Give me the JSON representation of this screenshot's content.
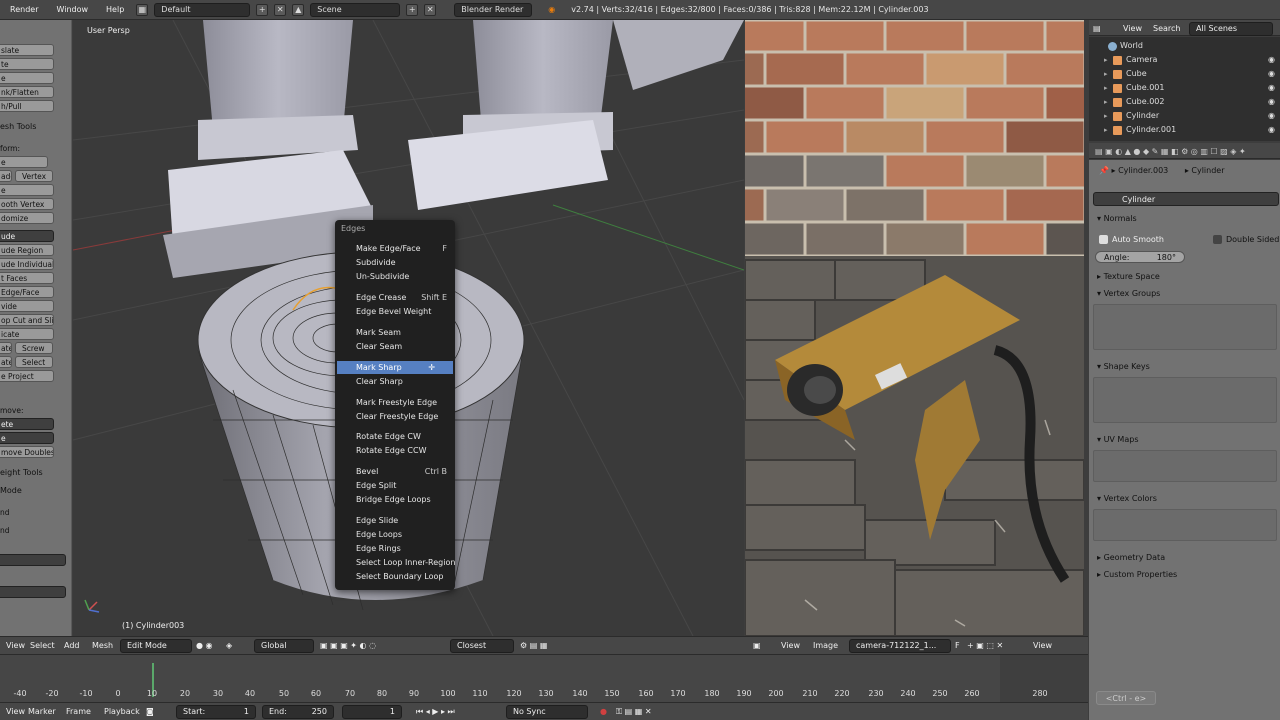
{
  "topbar": {
    "menus": [
      "Render",
      "Window",
      "Help"
    ],
    "screen_layout": "Default",
    "scene": "Scene",
    "engine": "Blender Render",
    "stats": "v2.74 | Verts:32/416 | Edges:32/800 | Faces:0/386 | Tris:828 | Mem:22.12M | Cylinder.003"
  },
  "toolshelf": {
    "items": [
      "slate",
      "te",
      "e",
      "nk/Flatten",
      "h/Pull",
      "esh Tools",
      "form:",
      "e",
      "ade Ed",
      "Vertex",
      "e",
      "ooth Vertex",
      "domize",
      "ude",
      "ude Region",
      "ude Individual",
      "t Faces",
      "Edge/Face",
      "vide",
      "op Cut and Sli...",
      "icate",
      "ate",
      "Screw",
      "ate",
      "Select",
      "e Project",
      "move:",
      "ete",
      "e",
      "move Doubles",
      "eight Tools",
      "Mode",
      "nd",
      "nd"
    ]
  },
  "viewport": {
    "view_name": "User Persp",
    "object_label": "(1) Cylinder003"
  },
  "context_menu": {
    "title": "Edges",
    "items": [
      {
        "label": "Make Edge/Face",
        "shortcut": "F"
      },
      {
        "label": "Subdivide",
        "shortcut": ""
      },
      {
        "label": "Un-Subdivide",
        "shortcut": ""
      },
      {
        "label": "Edge Crease",
        "shortcut": "Shift E"
      },
      {
        "label": "Edge Bevel Weight",
        "shortcut": ""
      },
      {
        "label": "Mark Seam",
        "shortcut": ""
      },
      {
        "label": "Clear Seam",
        "shortcut": ""
      },
      {
        "label": "Mark Sharp",
        "shortcut": ""
      },
      {
        "label": "Clear Sharp",
        "shortcut": ""
      },
      {
        "label": "Mark Freestyle Edge",
        "shortcut": ""
      },
      {
        "label": "Clear Freestyle Edge",
        "shortcut": ""
      },
      {
        "label": "Rotate Edge CW",
        "shortcut": ""
      },
      {
        "label": "Rotate Edge CCW",
        "shortcut": ""
      },
      {
        "label": "Bevel",
        "shortcut": "Ctrl B"
      },
      {
        "label": "Edge Split",
        "shortcut": ""
      },
      {
        "label": "Bridge Edge Loops",
        "shortcut": ""
      },
      {
        "label": "Edge Slide",
        "shortcut": ""
      },
      {
        "label": "Edge Loops",
        "shortcut": ""
      },
      {
        "label": "Edge Rings",
        "shortcut": ""
      },
      {
        "label": "Select Loop Inner-Region",
        "shortcut": ""
      },
      {
        "label": "Select Boundary Loop",
        "shortcut": ""
      }
    ],
    "highlighted": "Mark Sharp"
  },
  "outliner": {
    "header": {
      "view": "View",
      "search": "Search",
      "scenes": "All Scenes"
    },
    "rows": [
      {
        "label": "World",
        "color": "#8ab0d0"
      },
      {
        "label": "Camera",
        "color": "#e89a5a"
      },
      {
        "label": "Cube",
        "color": "#e89a5a"
      },
      {
        "label": "Cube.001",
        "color": "#e89a5a"
      },
      {
        "label": "Cube.002",
        "color": "#e89a5a"
      },
      {
        "label": "Cylinder",
        "color": "#e89a5a"
      },
      {
        "label": "Cylinder.001",
        "color": "#e89a5a"
      }
    ]
  },
  "properties": {
    "breadcrumb_object": "Cylinder.003",
    "breadcrumb_mesh": "Cylinder",
    "mesh_name": "Cylinder",
    "normals": "Normals",
    "auto_smooth": "Auto Smooth",
    "double_sided": "Double Sided",
    "angle_label": "Angle:",
    "angle_value": "180°",
    "panels": [
      "Texture Space",
      "Vertex Groups",
      "Shape Keys",
      "UV Maps",
      "Vertex Colors",
      "Geometry Data",
      "Custom Properties"
    ]
  },
  "view_header": {
    "view": "View",
    "select": "Select",
    "add": "Add",
    "mesh": "Mesh",
    "mode": "Edit Mode",
    "orientation": "Global",
    "snap": "Closest"
  },
  "image_header": {
    "view": "View",
    "image": "Image",
    "image_name": "camera-712122_1...",
    "fake": "F",
    "view2": "View"
  },
  "timeline": {
    "ticks": [
      "-40",
      "-20",
      "-10",
      "0",
      "10",
      "20",
      "30",
      "40",
      "50",
      "60",
      "70",
      "80",
      "90",
      "100",
      "110",
      "120",
      "130",
      "140",
      "150",
      "160",
      "170",
      "180",
      "190",
      "200",
      "210",
      "220",
      "230",
      "240",
      "250",
      "260",
      "280"
    ],
    "view": "View",
    "marker": "Marker",
    "frame": "Frame",
    "playback": "Playback",
    "start_label": "Start:",
    "start": "1",
    "end_label": "End:",
    "end": "250",
    "current": "1",
    "sync": "No Sync"
  },
  "hint": "<Ctrl - e>"
}
